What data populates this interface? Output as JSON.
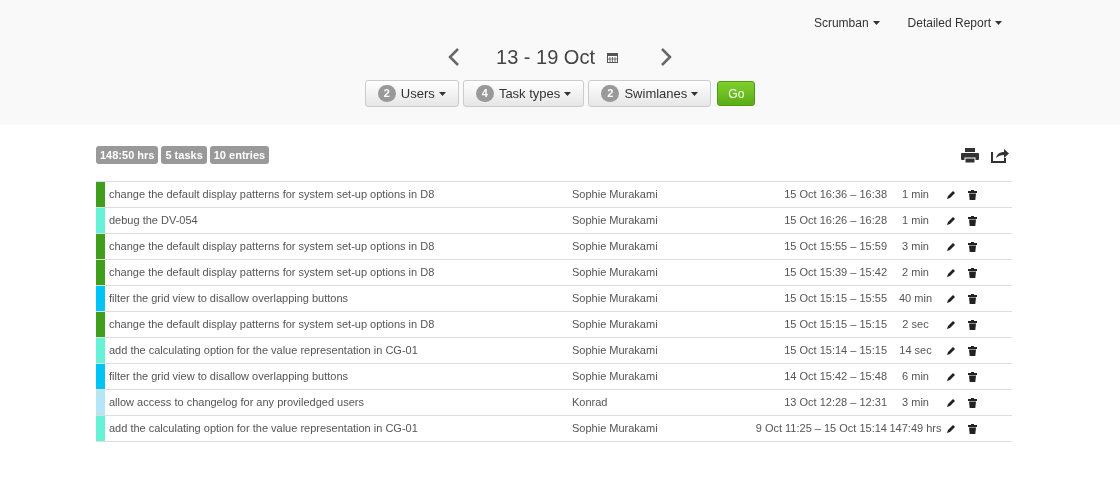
{
  "top_menu": [
    {
      "label": "Scrumban"
    },
    {
      "label": "Detailed Report"
    }
  ],
  "date_nav": {
    "range": "13 - 19 Oct"
  },
  "filters": [
    {
      "count": "2",
      "label": "Users"
    },
    {
      "count": "4",
      "label": "Task types"
    },
    {
      "count": "2",
      "label": "Swimlanes"
    }
  ],
  "go_button": "Go",
  "summary": [
    "148:50 hrs",
    "5 tasks",
    "10 entries"
  ],
  "entries": [
    {
      "task": "change the default display patterns for system set-up options in D8",
      "color": "#3f9e1c",
      "user": "Sophie Murakami",
      "time": "15 Oct 16:36 – 16:38",
      "duration": "1 min"
    },
    {
      "task": "debug the DV-054",
      "color": "#66f2d6",
      "user": "Sophie Murakami",
      "time": "15 Oct 16:26 – 16:28",
      "duration": "1 min"
    },
    {
      "task": "change the default display patterns for system set-up options in D8",
      "color": "#3f9e1c",
      "user": "Sophie Murakami",
      "time": "15 Oct 15:55 – 15:59",
      "duration": "3 min"
    },
    {
      "task": "change the default display patterns for system set-up options in D8",
      "color": "#3f9e1c",
      "user": "Sophie Murakami",
      "time": "15 Oct 15:39 – 15:42",
      "duration": "2 min"
    },
    {
      "task": "filter the grid view to disallow overlapping buttons",
      "color": "#00c4f6",
      "user": "Sophie Murakami",
      "time": "15 Oct 15:15 – 15:55",
      "duration": "40 min"
    },
    {
      "task": "change the default display patterns for system set-up options in D8",
      "color": "#3f9e1c",
      "user": "Sophie Murakami",
      "time": "15 Oct 15:15 – 15:15",
      "duration": "2 sec"
    },
    {
      "task": "add the calculating option for the value representation in CG-01",
      "color": "#66f2d6",
      "user": "Sophie Murakami",
      "time": "15 Oct 15:14 – 15:15",
      "duration": "14 sec"
    },
    {
      "task": "filter the grid view to disallow overlapping buttons",
      "color": "#00c4f6",
      "user": "Sophie Murakami",
      "time": "14 Oct 15:42 – 15:48",
      "duration": "6 min"
    },
    {
      "task": "allow access to changelog for any proviledged users",
      "color": "#b5e6f5",
      "user": "Konrad",
      "time": "13 Oct 12:28 – 12:31",
      "duration": "3 min"
    },
    {
      "task": "add the calculating option for the value representation in CG-01",
      "color": "#66f2d6",
      "user": "Sophie Murakami",
      "time": "9 Oct 11:25 – 15 Oct 15:14",
      "duration": "147:49 hrs"
    }
  ]
}
